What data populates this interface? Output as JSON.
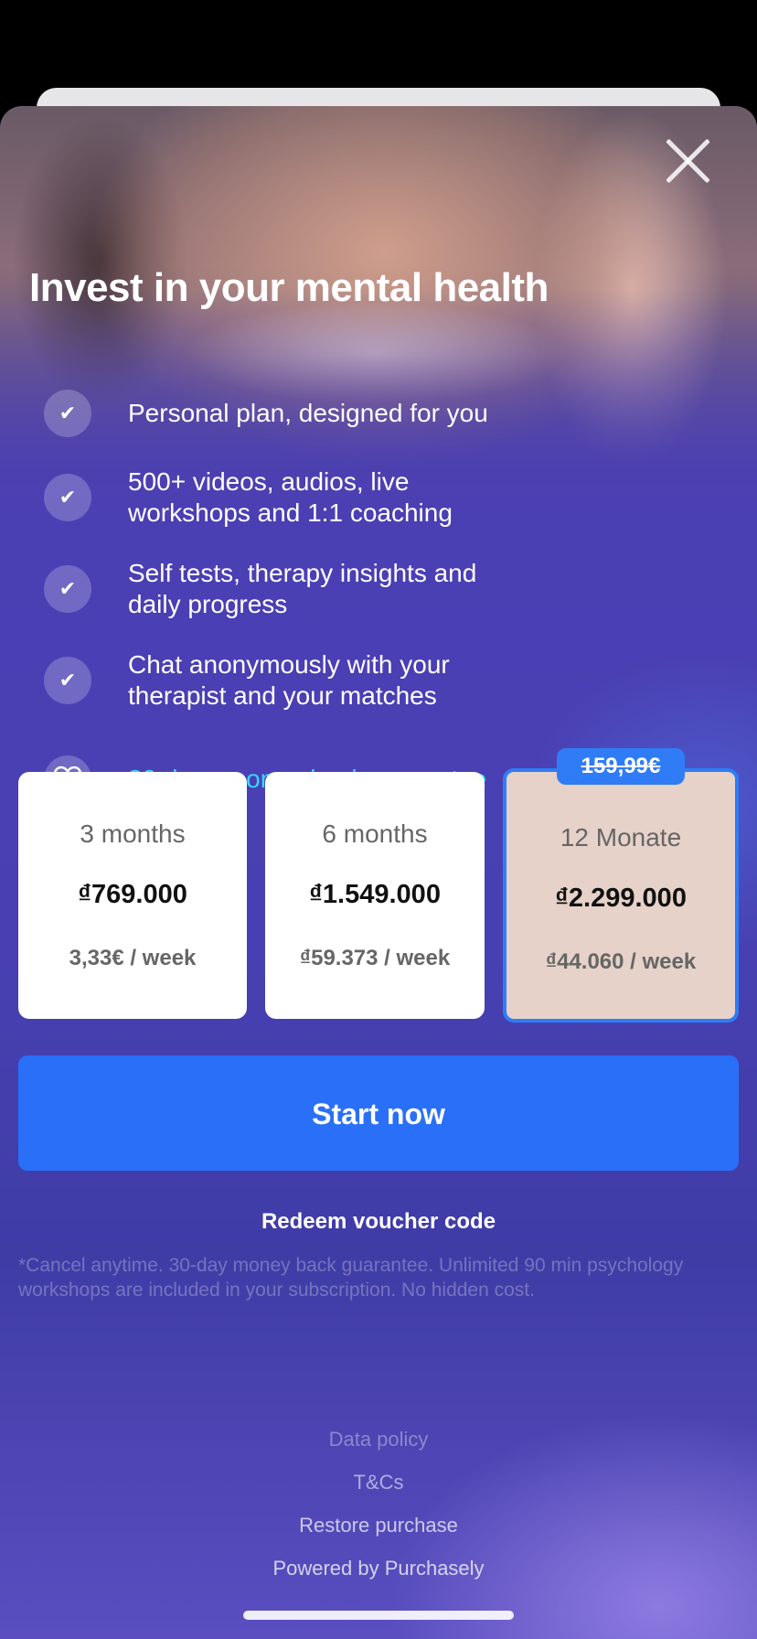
{
  "title": "Invest in your mental health",
  "features": [
    {
      "icon": "check-icon",
      "text": "Personal plan, designed for you"
    },
    {
      "icon": "check-icon",
      "text": "500+ videos, audios, live workshops and 1:1 coaching"
    },
    {
      "icon": "check-icon",
      "text": "Self tests, therapy insights and daily progress"
    },
    {
      "icon": "check-icon",
      "text": "Chat anonymously with your therapist and your matches"
    },
    {
      "icon": "heart-icon",
      "text": "30 days money-back guarantee"
    }
  ],
  "plans": [
    {
      "name": "3 months",
      "price": "₫769.000",
      "per_week": "3,33€ / week",
      "selected": false
    },
    {
      "name": "6 months",
      "price": "₫1.549.000",
      "per_week": "₫59.373 / week",
      "selected": false
    },
    {
      "name": "12 Monate",
      "price": "₫2.299.000",
      "per_week": "₫44.060 / week",
      "selected": true,
      "original_price": "159,99€"
    }
  ],
  "cta_label": "Start now",
  "redeem_label": "Redeem voucher code",
  "disclaimer": "*Cancel anytime. 30-day money back guarantee. Unlimited 90 min psychology workshops are included in your subscription. No hidden cost.",
  "footer_links": [
    "Data policy",
    "T&Cs",
    "Restore purchase",
    "Powered by Purchasely"
  ],
  "colors": {
    "accent": "#2a6ff7",
    "guarantee_text": "#37d6ff",
    "selected_plan_bg": "#e6d2c8"
  }
}
